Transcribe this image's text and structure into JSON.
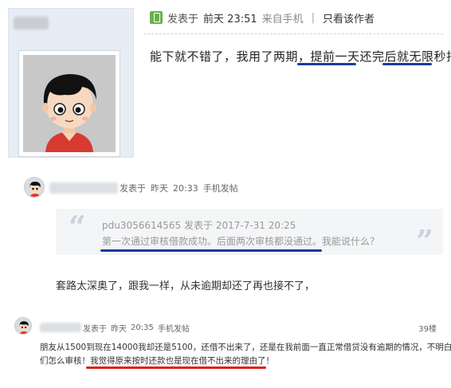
{
  "post1": {
    "mobile_icon": "mobile-phone-icon",
    "posted_label": "发表于",
    "day": "前天",
    "time": "23:51",
    "from_label": "来自手机",
    "separator": "|",
    "only_author_label": "只看该作者",
    "content_before": "能下就不错了，我用了两期，",
    "content_highlight1": "提前一天还完",
    "content_middle": "后就",
    "content_highlight2": "无限秒拒"
  },
  "post2": {
    "meta_posted": "发表于",
    "meta_day": "昨天",
    "meta_time": "20:33",
    "meta_source": "手机发帖",
    "quote": {
      "user": "pdu3056614565",
      "posted_label": "发表于",
      "date": "2017-7-31",
      "time": "20:25",
      "text": "第一次通过审核借款成功。后面两次审核都没通过。我能说什么？",
      "open_mark": "“",
      "close_mark": "”"
    },
    "content": "套路太深奥了，跟我一样，从未逾期却还了再也接不了，"
  },
  "post3": {
    "meta_posted": "发表于",
    "meta_day": "昨天",
    "meta_time": "20:35",
    "meta_source": "手机发帖",
    "floor": "39楼",
    "content_line1": "朋友从1500到现在14000我却还是5100，还借不出来了，还是在我前面一直正常借贷没有逾期的情况，不明白你",
    "content_line2_before": "们怎么审核！",
    "content_line2_highlight": "我觉得原来按时还款也是现在借不出来的理由了！"
  },
  "colors": {
    "underline_blue": "#1a3a9e",
    "underline_red": "#e0201b",
    "sidebar_bg": "#e7edf4"
  }
}
